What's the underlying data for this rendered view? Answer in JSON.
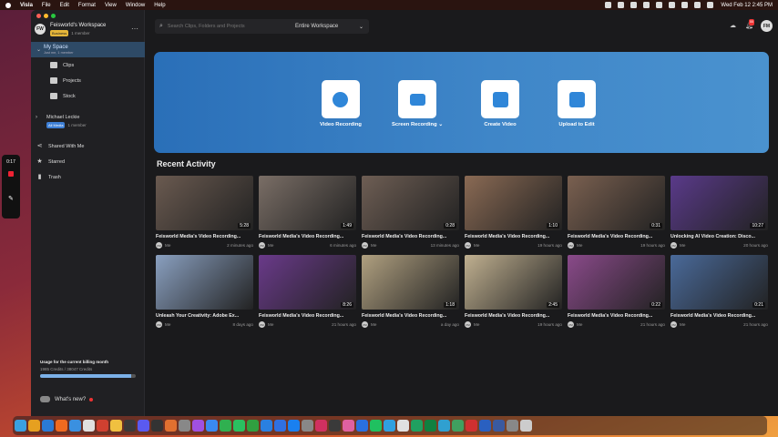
{
  "menubar": {
    "app_name": "Visla",
    "menus": [
      "File",
      "Edit",
      "Format",
      "View",
      "Window",
      "Help"
    ],
    "clock": "Wed Feb 12  2:45 PM"
  },
  "recorder": {
    "time": "0:17"
  },
  "workspace": {
    "initials": "FW",
    "title": "Feisworld's Workspace",
    "plan": "Business",
    "members": "1 member"
  },
  "sidebar": {
    "my_space": {
      "label": "My Space",
      "sub": "Just me, 1 member"
    },
    "sub_items": [
      {
        "label": "Clips",
        "icon": "clips-icon"
      },
      {
        "label": "Projects",
        "icon": "projects-icon"
      },
      {
        "label": "Stock",
        "icon": "stock-icon"
      }
    ],
    "michael": {
      "name": "Michael Leckie",
      "badge": "All Media",
      "members": "1 member"
    },
    "main_items": [
      {
        "label": "Shared With Me",
        "icon": "share-icon",
        "glyph": "⋖"
      },
      {
        "label": "Starred",
        "icon": "star-icon",
        "glyph": "★"
      },
      {
        "label": "Trash",
        "icon": "trash-icon",
        "glyph": "▮"
      }
    ],
    "usage": {
      "title": "Usage for the current billing month",
      "text": "1985 Credits / 38047 Credits",
      "fraction": 0.95
    },
    "whats_new": "What's new?"
  },
  "topbar": {
    "search_placeholder": "Search Clips, Folders and Projects",
    "workspace_select": "Entire Workspace",
    "notif_count": "55",
    "user_initials": "FM"
  },
  "hero": {
    "actions": [
      {
        "label": "Video Recording",
        "icon": "webcam-icon"
      },
      {
        "label": "Screen Recording",
        "icon": "monitor-icon",
        "dropdown": "⌄"
      },
      {
        "label": "Create Video",
        "icon": "film-icon"
      },
      {
        "label": "Upload to Edit",
        "icon": "upload-icon"
      }
    ]
  },
  "recent_title": "Recent Activity",
  "cards": [
    {
      "title": "Feisworld Media's Video Recording...",
      "duration": "5:28",
      "owner": "Me",
      "time": "2 minutes ago",
      "bg": "#6a5a50"
    },
    {
      "title": "Feisworld Media's Video Recording...",
      "duration": "1:49",
      "owner": "Me",
      "time": "6 minutes ago",
      "bg": "#7a6e66"
    },
    {
      "title": "Feisworld Media's Video Recording...",
      "duration": "0:28",
      "owner": "Me",
      "time": "13 minutes ago",
      "bg": "#6e5e54"
    },
    {
      "title": "Feisworld Media's Video Recording...",
      "duration": "1:10",
      "owner": "Me",
      "time": "19 hours ago",
      "bg": "#8a6a54"
    },
    {
      "title": "Feisworld Media's Video Recording...",
      "duration": "0:31",
      "owner": "Me",
      "time": "19 hours ago",
      "bg": "#7a6050"
    },
    {
      "title": "Unlocking AI Video Creation: Disco...",
      "duration": "10:27",
      "owner": "Me",
      "time": "20 hours ago",
      "bg": "#5a3a8a"
    },
    {
      "title": "Unleash Your Creativity: Adobe Ex...",
      "duration": "",
      "owner": "Me",
      "time": "8 days ago",
      "bg": "#8aa0c0"
    },
    {
      "title": "Feisworld Media's Video Recording...",
      "duration": "8:26",
      "owner": "Me",
      "time": "21 hours ago",
      "bg": "#6a3a8a"
    },
    {
      "title": "Feisworld Media's Video Recording...",
      "duration": "1:18",
      "owner": "Me",
      "time": "a day ago",
      "bg": "#b0a080"
    },
    {
      "title": "Feisworld Media's Video Recording...",
      "duration": "2:45",
      "owner": "Me",
      "time": "19 hours ago",
      "bg": "#c0b090"
    },
    {
      "title": "Feisworld Media's Video Recording...",
      "duration": "0:22",
      "owner": "Me",
      "time": "21 hours ago",
      "bg": "#8a4a8a"
    },
    {
      "title": "Feisworld Media's Video Recording...",
      "duration": "0:21",
      "owner": "Me",
      "time": "21 hours ago",
      "bg": "#4a6a9a"
    }
  ],
  "dock_apps": [
    "#3aa0e0",
    "#e6a020",
    "#2a7ad6",
    "#f06a20",
    "#3a90e0",
    "#e0e0e0",
    "#d04030",
    "#f0c040",
    "#3a3a3a",
    "#5a5af0",
    "#333",
    "#e07030",
    "#888",
    "#a050e0",
    "#3a8af0",
    "#30b050",
    "#2ac060",
    "#30a040",
    "#2a80e0",
    "#3070e0",
    "#1a80f0",
    "#888",
    "#d03060",
    "#3a3a3a",
    "#e060a0",
    "#2a70e0",
    "#20c060",
    "#30a0e0",
    "#e0e0e0",
    "#20a060",
    "#108040",
    "#30a0d0",
    "#40a060",
    "#d03030",
    "#2a60c0",
    "#3a5aa0",
    "#888",
    "#ccc"
  ]
}
